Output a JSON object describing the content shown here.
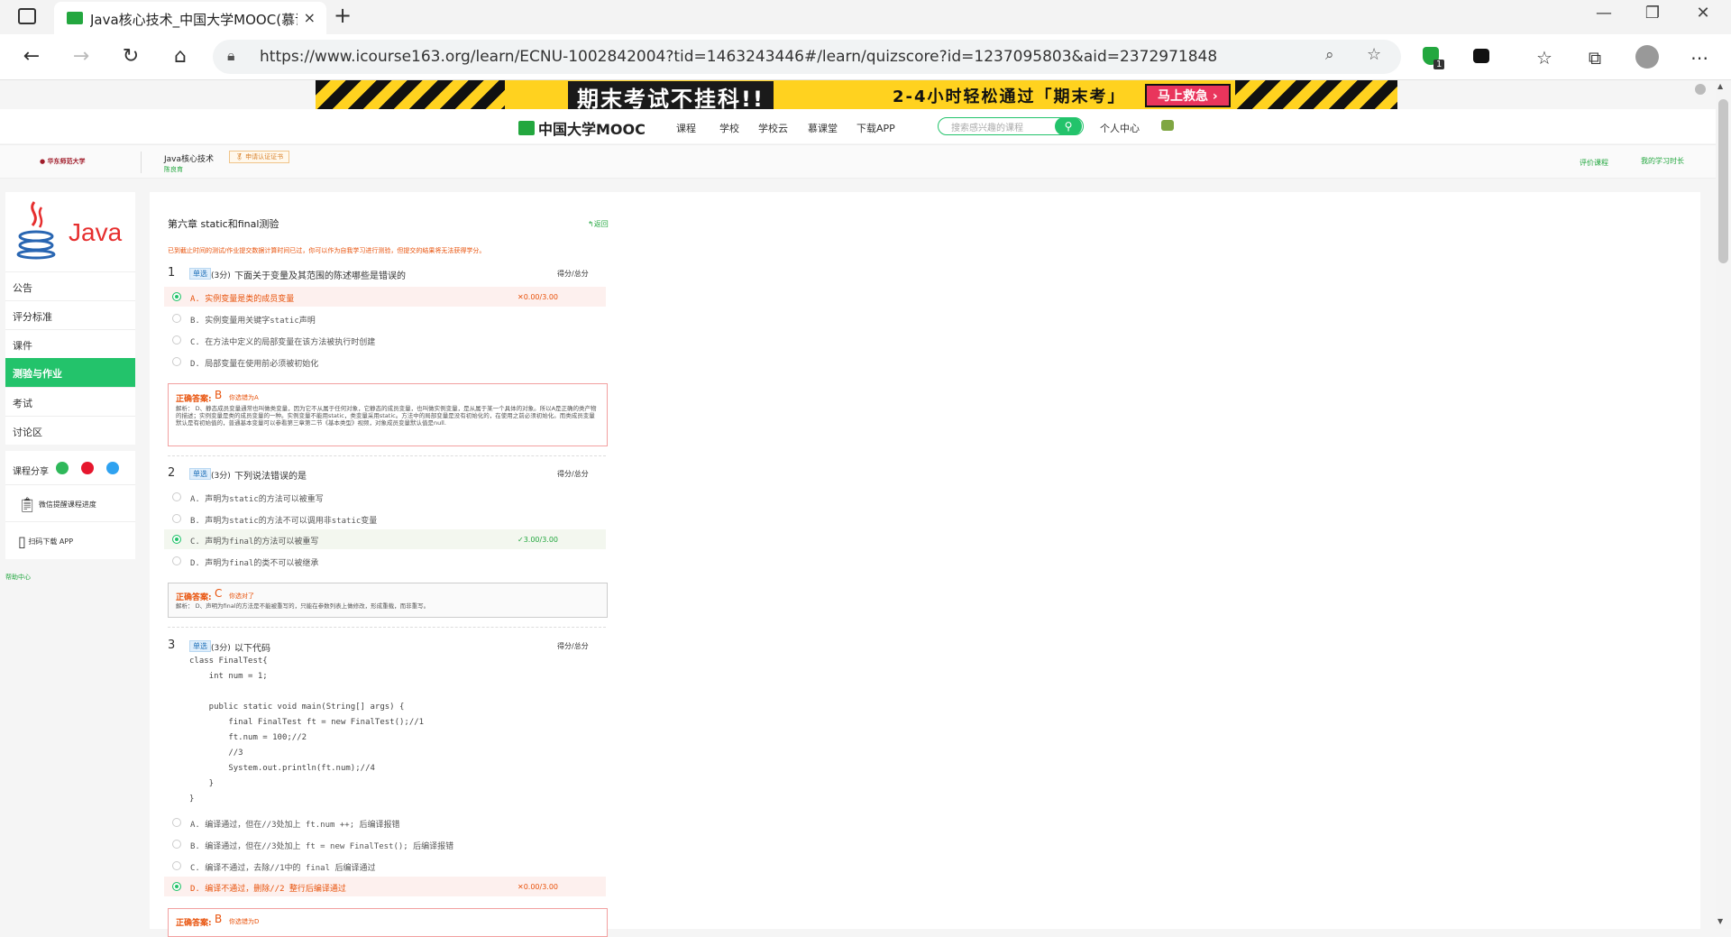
{
  "browser": {
    "tab_title": "Java核心技术_中国大学MOOC(慕课)",
    "tab_close": "×",
    "new_tab": "+",
    "url": "https://www.icourse163.org/learn/ECNU-1002842004?tid=1463243446#/learn/quizscore?id=1237095803&aid=2372971848",
    "ext_badge": "1"
  },
  "banner": {
    "headline": "期末考试不挂科!!",
    "sub": "2-4小时轻松通过「期末考」",
    "cta": "马上救急 ›"
  },
  "site_nav": {
    "logo": "中国大学MOOC",
    "items": [
      "课程",
      "学校",
      "学校云",
      "慕课堂",
      "下载APP"
    ],
    "search_placeholder": "搜索感兴趣的课程",
    "personal": "个人中心"
  },
  "course_bar": {
    "school": "华东师范大学",
    "course_name": "Java核心技术",
    "teacher": "陈良育",
    "cert": "申请认证证书",
    "rate": "评价课程",
    "study_time": "我的学习时长"
  },
  "sidebar": {
    "java_logo": "Java",
    "items": [
      "公告",
      "评分标准",
      "课件",
      "测验与作业",
      "考试",
      "讨论区"
    ],
    "share_label": "课程分享",
    "wechat_progress": "微信提醒课程进度",
    "download_app": "扫码下载 APP",
    "help": "帮助中心"
  },
  "quiz": {
    "title": "第六章 static和final测验",
    "back": "返回",
    "notice": "已到截止时间的测试/作业提交数据计算时间已过，你可以作为自我学习进行测验，但提交的结果将无法获得学分。",
    "questions": [
      {
        "num": "1",
        "type": "单选",
        "points": "(3分)",
        "text": "下面关于变量及其范围的陈述哪些是错误的",
        "score_label": "得分/总分",
        "options": [
          {
            "text": "A. 实例变量是类的成员变量",
            "selected": true,
            "result": "✕0.00/3.00"
          },
          {
            "text": "B. 实例变量用关键字static声明",
            "selected": false,
            "result": ""
          },
          {
            "text": "C. 在方法中定义的局部变量在该方法被执行时创建",
            "selected": false,
            "result": ""
          },
          {
            "text": "D. 局部变量在使用前必须被初始化",
            "selected": false,
            "result": ""
          }
        ],
        "answer_label": "正确答案:",
        "answer": "B",
        "answer_note": "你选错为A",
        "explanation": "解析：  D、静态成员变量通常也叫做类变量，因为它不从属于任何对象，它静态的成员变量，也叫做实例变量，是从属于某一个具体的对象。所以A是正确的类产物的描述；实例变量是类的成员变量的一种。实例变量不能用static，类变量采用static。方法中的局部变量是没有初始化的，在使用之前必须初始化。而类成员变量默认是有初始值的，普通基本变量可以参看第三章第二节《基本类型》视频，对象成员变量默认值是null."
      },
      {
        "num": "2",
        "type": "单选",
        "points": "(3分)",
        "text": "下列说法错误的是",
        "score_label": "得分/总分",
        "options": [
          {
            "text": "A. 声明为static的方法可以被重写",
            "selected": false,
            "result": ""
          },
          {
            "text": "B. 声明为static的方法不可以调用非static变量",
            "selected": false,
            "result": ""
          },
          {
            "text": "C. 声明为final的方法可以被重写",
            "selected": true,
            "result": "✓3.00/3.00"
          },
          {
            "text": "D. 声明为final的类不可以被继承",
            "selected": false,
            "result": ""
          }
        ],
        "answer_label": "正确答案:",
        "answer": "C",
        "answer_note": "你选对了",
        "explanation": "解析：  D、声明为final的方法是不能被重写的，只能在参数列表上做修改，形成重载，而非重写。"
      },
      {
        "num": "3",
        "type": "单选",
        "points": "(3分)",
        "text": "以下代码",
        "score_label": "得分/总分",
        "code": [
          "class FinalTest{",
          "    int num = 1;",
          "",
          "    public static void main(String[] args) {",
          "        final FinalTest ft = new FinalTest();//1",
          "        ft.num = 100;//2",
          "        //3",
          "        System.out.println(ft.num);//4",
          "    }",
          "}"
        ],
        "options": [
          {
            "text": "A. 编译通过，但在//3处加上  ft.num ++; 后编译报错",
            "selected": false,
            "result": ""
          },
          {
            "text": "B. 编译通过，但在//3处加上  ft = new FinalTest(); 后编译报错",
            "selected": false,
            "result": ""
          },
          {
            "text": "C. 编译不通过，去除//1中的  final 后编译通过",
            "selected": false,
            "result": ""
          },
          {
            "text": "D. 编译不通过，删除//2 整行后编译通过",
            "selected": true,
            "result": "✕0.00/3.00"
          }
        ],
        "answer_label": "正确答案:",
        "answer": "B",
        "answer_note": "你选错为D"
      }
    ]
  }
}
